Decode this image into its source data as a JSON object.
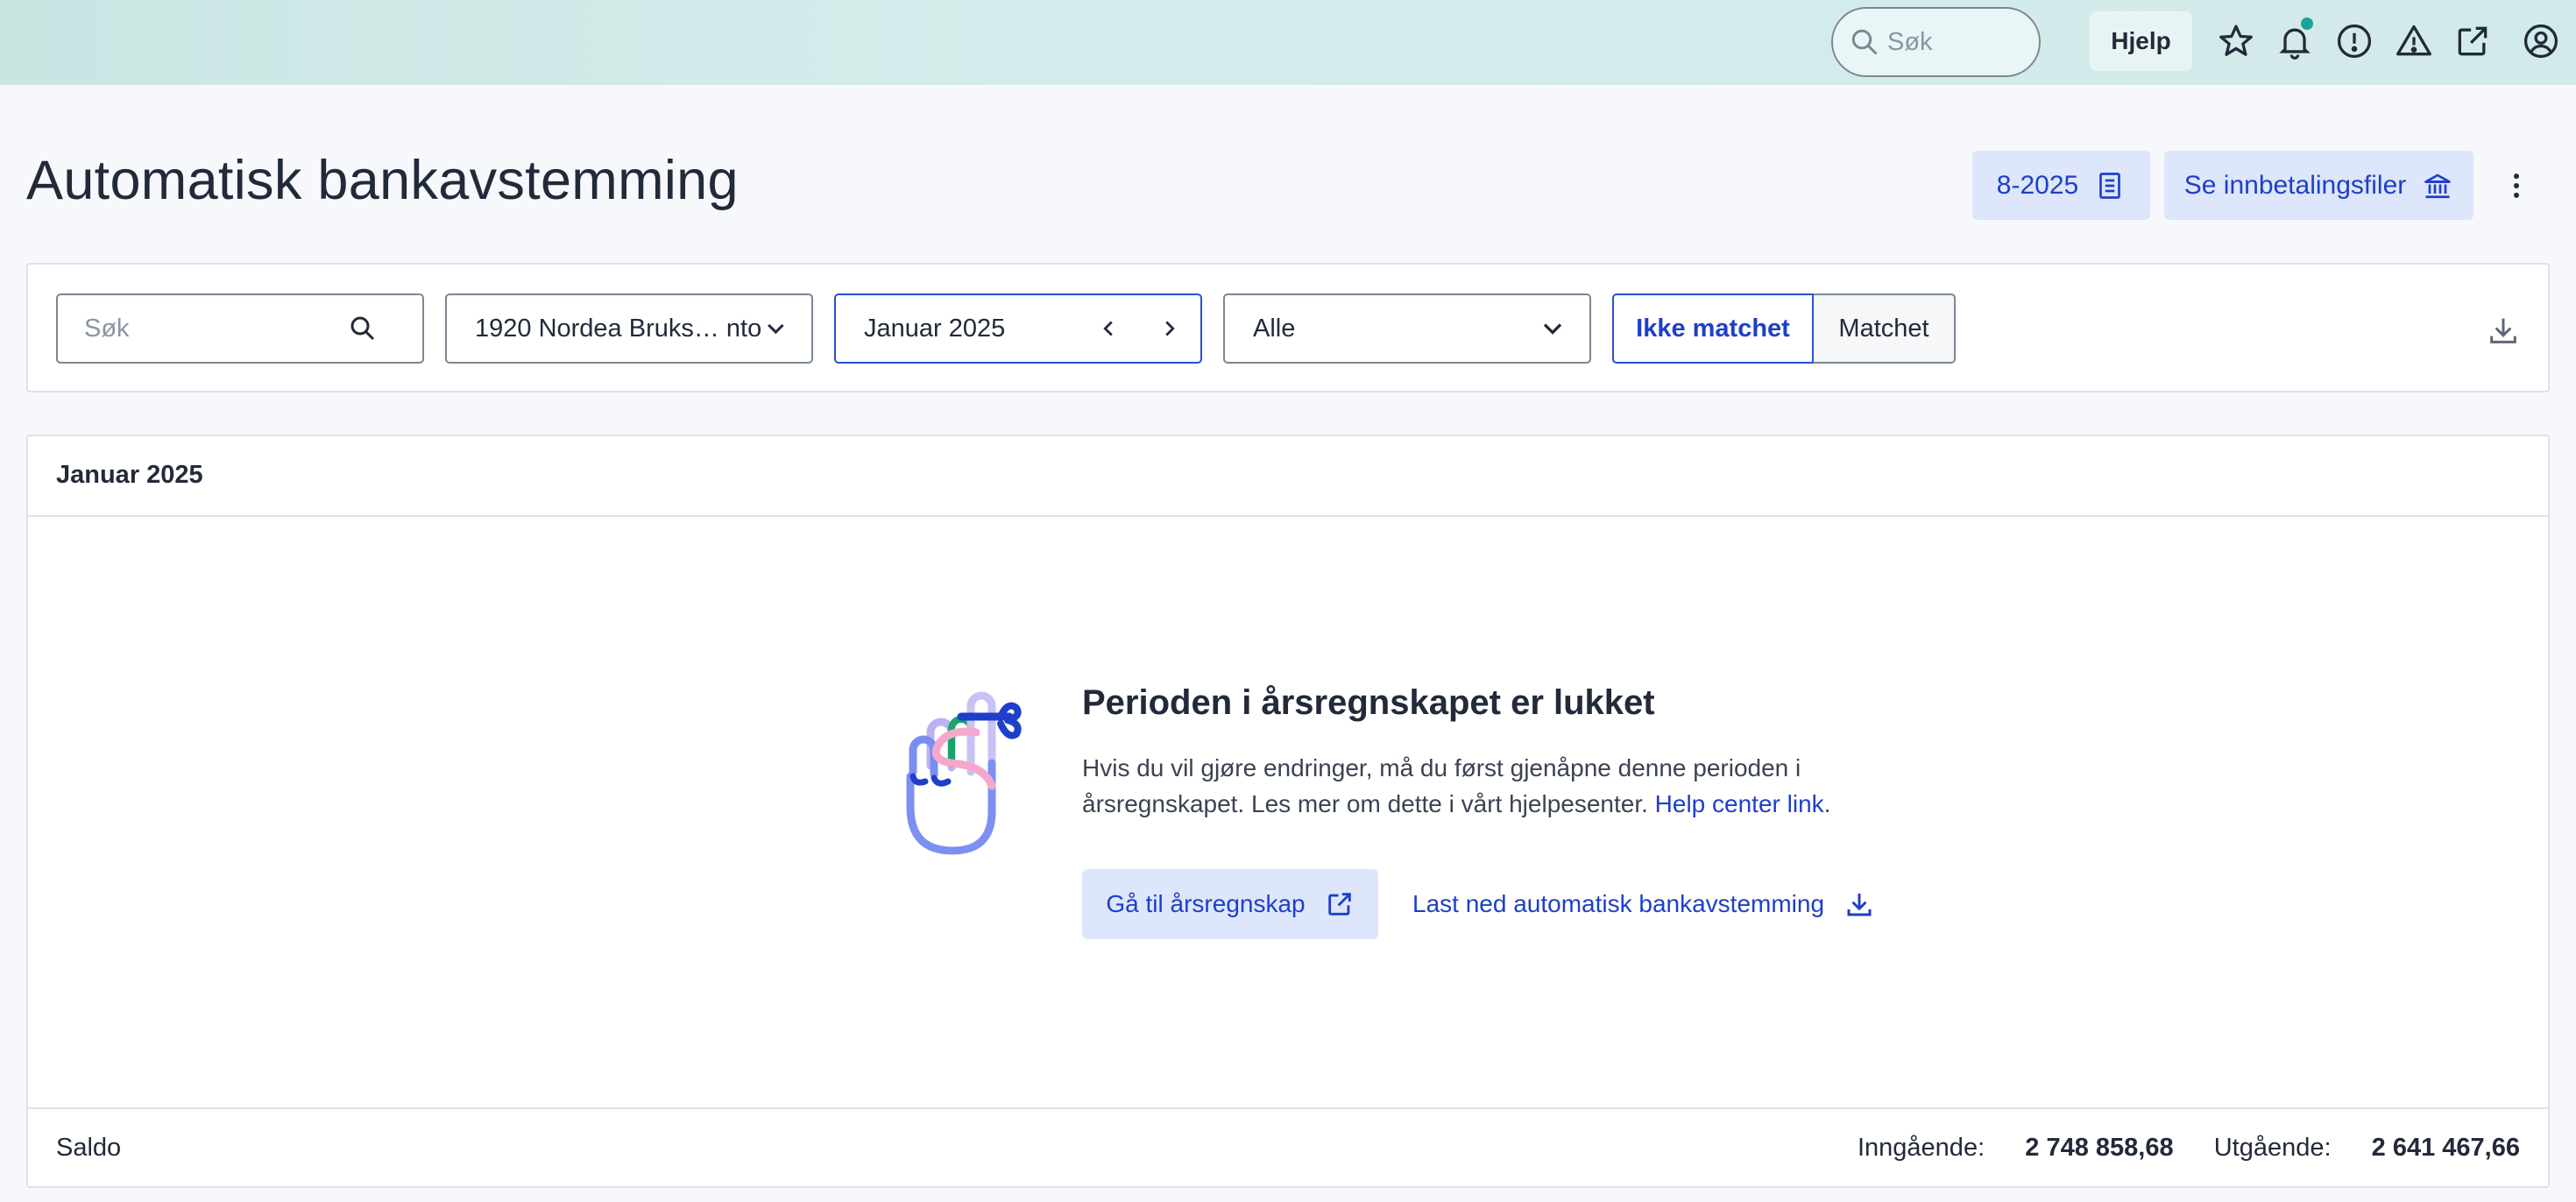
{
  "topbar": {
    "search_placeholder": "Søk",
    "help_label": "Hjelp",
    "icons": [
      "star-icon",
      "bell-icon",
      "alert-circle-icon",
      "warning-icon",
      "external-link-icon",
      "user-circle-icon"
    ],
    "notification_dot_color": "#1aa39a"
  },
  "header": {
    "title": "Automatisk bankavstemming",
    "period_button_label": "8-2025",
    "payment_files_button_label": "Se innbetalingsfiler"
  },
  "filters": {
    "search_placeholder": "Søk",
    "account_value": "1920 Nordea Bruks… nto",
    "period_value": "Januar 2025",
    "status_value": "Alle",
    "toggle": {
      "active_label": "Ikke matchet",
      "inactive_label": "Matchet"
    }
  },
  "card": {
    "heading": "Januar 2025",
    "empty_state": {
      "title": "Perioden i årsregnskapet er lukket",
      "text": "Hvis du vil gjøre endringer, må du først gjenåpne denne perioden i årsregnskapet. Les mer om dette i vårt hjelpesenter. ",
      "link_text": "Help center link",
      "text_end": ".",
      "primary_button_label": "Gå til årsregnskap",
      "secondary_link_label": "Last ned automatisk bankavstemming"
    },
    "footer": {
      "saldo_label": "Saldo",
      "incoming_label": "Inngående:",
      "incoming_value": "2 748 858,68",
      "outgoing_label": "Utgående:",
      "outgoing_value": "2 641 467,66"
    }
  },
  "colors": {
    "accent": "#1e3fc9",
    "accent_bg": "#dde6fb",
    "topbar_bg": "#c9e6e3"
  }
}
